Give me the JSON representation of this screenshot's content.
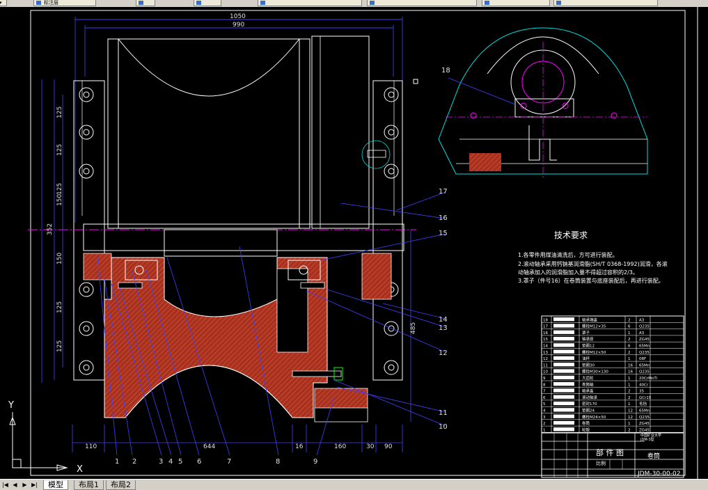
{
  "window_tabs": [
    {
      "label": "标注层"
    },
    {
      "label": ""
    },
    {
      "label": ""
    },
    {
      "label": ""
    },
    {
      "label": ""
    },
    {
      "label": ""
    }
  ],
  "drawing": {
    "dims": {
      "total_width": "1050",
      "inner_width": "990",
      "left_margin": "110",
      "center": "644",
      "gap": "16",
      "right1": "160",
      "right2": "30",
      "right3": "90",
      "height_left": "352",
      "height_right": "485",
      "v_125a": "125",
      "v_125b": "125",
      "v_125c": "125",
      "v_150a": "150",
      "v_150b": "150",
      "v_125d": "125",
      "v_125e": "125"
    },
    "leaders_bottom": [
      "1",
      "2",
      "3",
      "4",
      "5",
      "6",
      "7",
      "8",
      "9"
    ],
    "leaders_right": [
      "17",
      "16",
      "15",
      "14",
      "13",
      "12",
      "11",
      "10"
    ],
    "side_leader": "18"
  },
  "tech_req": {
    "title": "技术要求",
    "lines": [
      "1.各零件用煤油清洗后，方可进行装配。",
      "2.滚动轴承采用钙钠基润滑脂(SH/T 0368-1992)润滑，各滚",
      "动轴承加入的润滑脂加入量不得超过容积的2/3。",
      "3.罩子（件号16）在卷筒装置与底座装配后，再进行装配。"
    ]
  },
  "bom": {
    "rows": [
      {
        "no": "18",
        "name": "轴承端盖",
        "qty": "2",
        "mat": "A3"
      },
      {
        "no": "17",
        "name": "螺栓M12×35",
        "qty": "6",
        "mat": "Q235"
      },
      {
        "no": "16",
        "name": "罩子",
        "qty": "1",
        "mat": "A3"
      },
      {
        "no": "15",
        "name": "轴承座",
        "qty": "2",
        "mat": "ZG45"
      },
      {
        "no": "14",
        "name": "垫圈12",
        "qty": "6",
        "mat": "65Mn"
      },
      {
        "no": "13",
        "name": "螺栓M12×50",
        "qty": "2",
        "mat": "Q235"
      },
      {
        "no": "12",
        "name": "油杯",
        "qty": "1",
        "mat": "08F"
      },
      {
        "no": "11",
        "name": "垫圈30",
        "qty": "16",
        "mat": "65Mn"
      },
      {
        "no": "10",
        "name": "螺栓M30×130",
        "qty": "16",
        "mat": "Q235"
      },
      {
        "no": "9",
        "name": "大齿轮",
        "qty": "1",
        "mat": "20CrMnTi"
      },
      {
        "no": "8",
        "name": "卷筒轴",
        "qty": "1",
        "mat": "40Cr"
      },
      {
        "no": "7",
        "name": "轴承盖",
        "qty": "2",
        "mat": "35"
      },
      {
        "no": "6",
        "name": "滚动轴承",
        "qty": "2",
        "mat": "GCr15"
      },
      {
        "no": "5",
        "name": "密封170",
        "qty": "1",
        "mat": "毛毡"
      },
      {
        "no": "4",
        "name": "垫圈24",
        "qty": "12",
        "mat": "65Mn"
      },
      {
        "no": "3",
        "name": "螺栓M24×50",
        "qty": "12",
        "mat": "Q235"
      },
      {
        "no": "2",
        "name": "卷筒",
        "qty": "1",
        "mat": "ZG45"
      },
      {
        "no": "1",
        "name": "轮毂",
        "qty": "2",
        "mat": "ZG45"
      }
    ],
    "part_title": "部 件 图",
    "school": "中国矿业大学",
    "project": "JDM-3型",
    "part_name": "卷筒",
    "drawing_no": "JDM-30-00-02",
    "scale_label": "比例"
  },
  "ucs": {
    "y_label": "Y",
    "x_label": "X"
  },
  "layout_tabs": {
    "model": "模型",
    "layout1": "布局1",
    "layout2": "布局2"
  },
  "colors": {
    "background": "#000000",
    "white_line": "#ffffff",
    "dim_line": "#4040ff",
    "center_line": "#ff00ff",
    "section_fill": "#b03020",
    "cyan_line": "#00e0e0",
    "yellow_line": "#e0e000"
  }
}
